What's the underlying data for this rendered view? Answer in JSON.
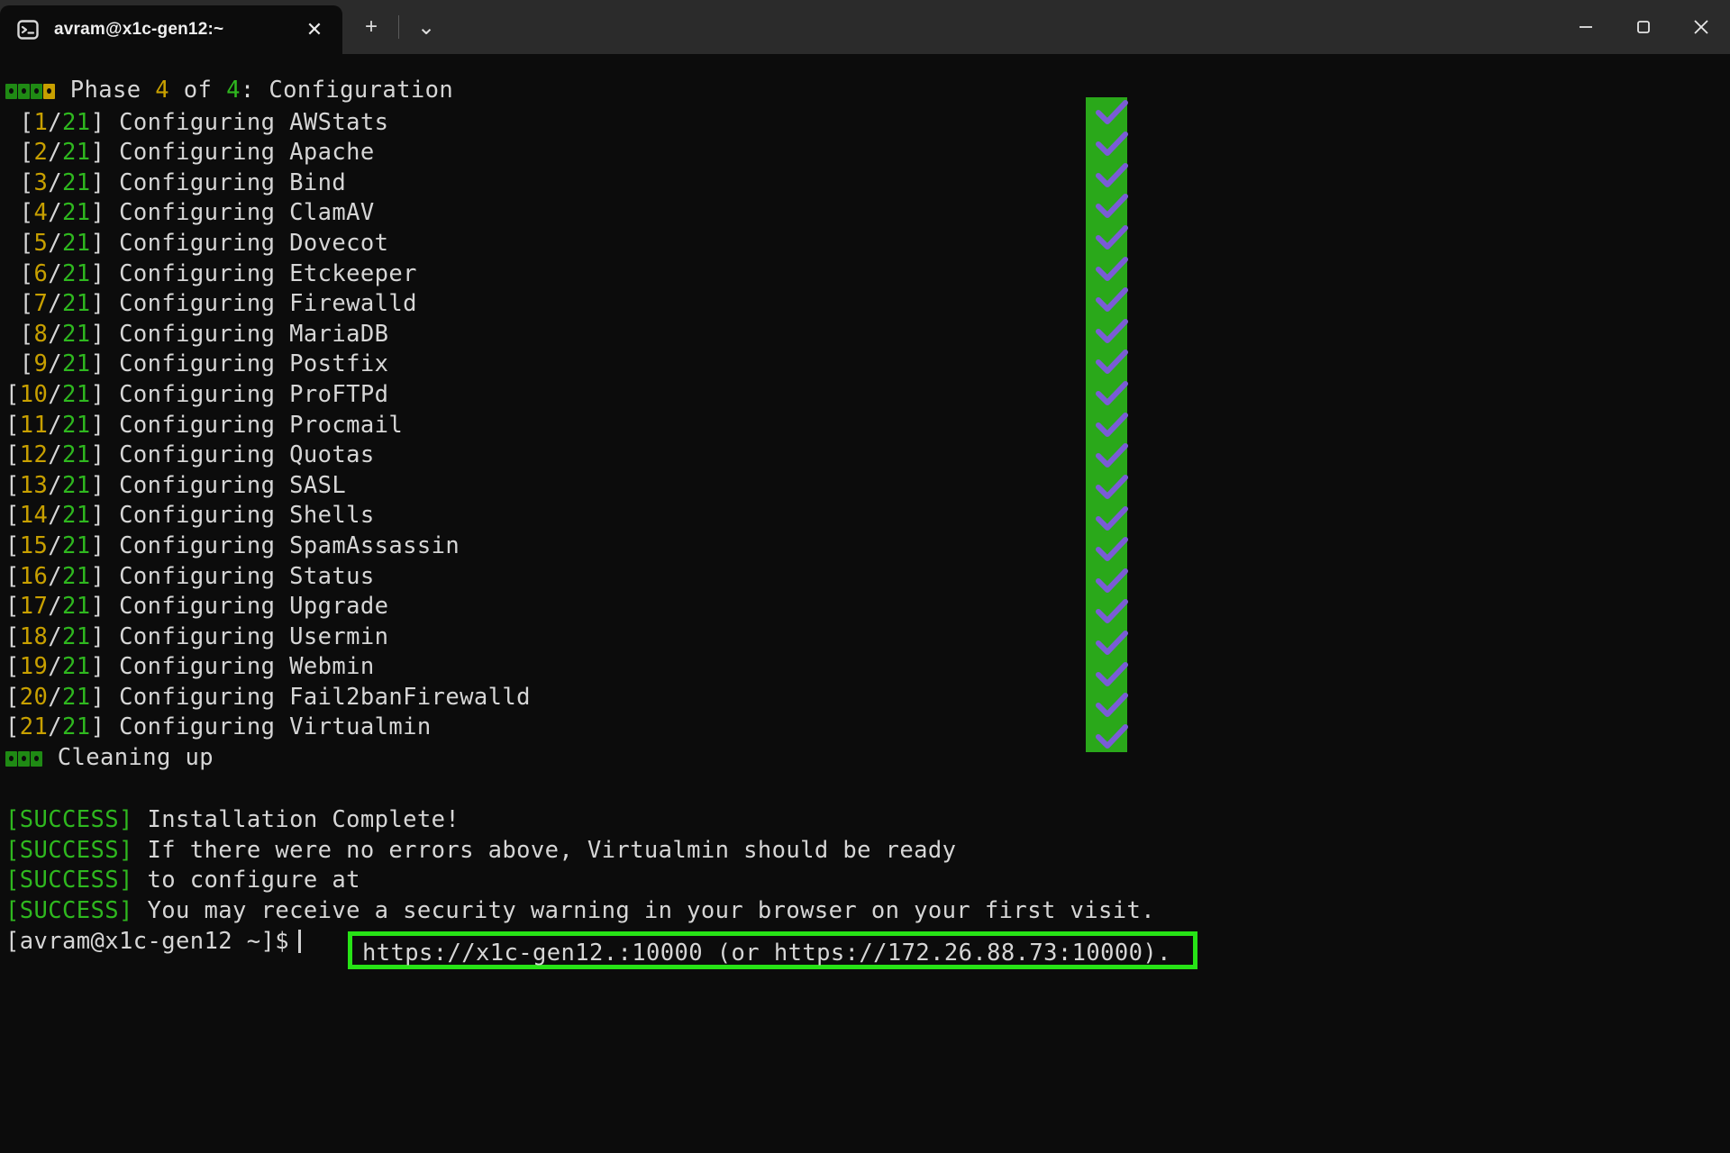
{
  "window": {
    "tab_title": "avram@x1c-gen12:~",
    "close_label": "✕",
    "new_tab_label": "+",
    "tab_menu_label": "⌄",
    "minimize_label": "—",
    "maximize_label": "□",
    "window_close_label": "✕",
    "colors": {
      "background": "#0c0c0c",
      "titlebar": "#2b2b2b",
      "text": "#cfcfcf",
      "green": "#2fb81f",
      "gold": "#c8a000",
      "highlight_green": "#27e316",
      "column_green": "#2aa81a",
      "check_purple": "#7a5cd6"
    }
  },
  "terminal": {
    "phase_header": {
      "blocks": [
        "g",
        "g",
        "g",
        "y"
      ],
      "prefix": "Phase ",
      "current": "4",
      "middle": " of ",
      "total": "4",
      "suffix": ": Configuration"
    },
    "total_steps": "21",
    "action_label": "Configuring",
    "steps": [
      {
        "index": "1",
        "name": "AWStats"
      },
      {
        "index": "2",
        "name": "Apache"
      },
      {
        "index": "3",
        "name": "Bind"
      },
      {
        "index": "4",
        "name": "ClamAV"
      },
      {
        "index": "5",
        "name": "Dovecot"
      },
      {
        "index": "6",
        "name": "Etckeeper"
      },
      {
        "index": "7",
        "name": "Firewalld"
      },
      {
        "index": "8",
        "name": "MariaDB"
      },
      {
        "index": "9",
        "name": "Postfix"
      },
      {
        "index": "10",
        "name": "ProFTPd"
      },
      {
        "index": "11",
        "name": "Procmail"
      },
      {
        "index": "12",
        "name": "Quotas"
      },
      {
        "index": "13",
        "name": "SASL"
      },
      {
        "index": "14",
        "name": "Shells"
      },
      {
        "index": "15",
        "name": "SpamAssassin"
      },
      {
        "index": "16",
        "name": "Status"
      },
      {
        "index": "17",
        "name": "Upgrade"
      },
      {
        "index": "18",
        "name": "Usermin"
      },
      {
        "index": "19",
        "name": "Webmin"
      },
      {
        "index": "20",
        "name": "Fail2banFirewalld"
      },
      {
        "index": "21",
        "name": "Virtualmin"
      }
    ],
    "cleanup": {
      "blocks": [
        "g",
        "g",
        "g"
      ],
      "text": "Cleaning up"
    },
    "success_tag": "[SUCCESS]",
    "messages": [
      "Installation Complete!",
      "If there were no errors above, Virtualmin should be ready",
      "to configure at",
      "You may receive a security warning in your browser on your first visit."
    ],
    "highlighted_url": "https://x1c-gen12.:10000 (or https://172.26.88.73:10000).",
    "prompt": "[avram@x1c-gen12 ~]$",
    "check_count": 21
  }
}
